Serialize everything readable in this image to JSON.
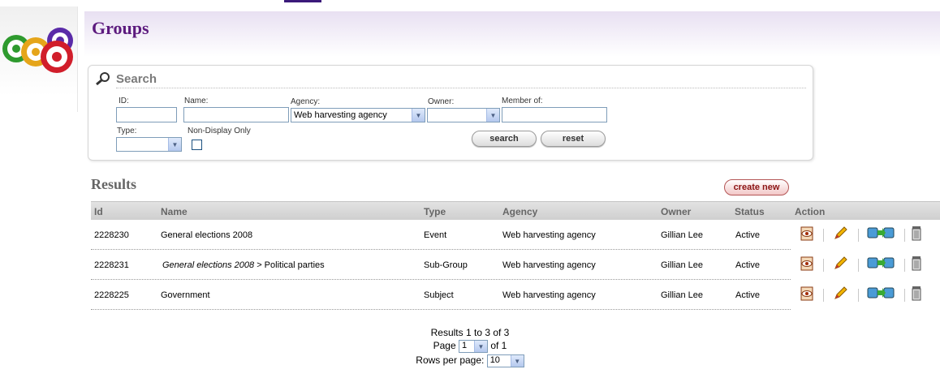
{
  "page_title": "Groups",
  "search": {
    "title": "Search",
    "id_label": "ID:",
    "id_value": "",
    "name_label": "Name:",
    "name_value": "",
    "agency_label": "Agency:",
    "agency_value": "Web harvesting agency",
    "owner_label": "Owner:",
    "owner_value": "",
    "member_label": "Member of:",
    "member_value": "",
    "type_label": "Type:",
    "type_value": "",
    "nondisplay_label": "Non-Display Only",
    "search_button": "search",
    "reset_button": "reset"
  },
  "results": {
    "title": "Results",
    "create_button": "create new",
    "columns": [
      "Id",
      "Name",
      "Type",
      "Agency",
      "Owner",
      "Status",
      "Action"
    ],
    "rows": [
      {
        "id": "2228230",
        "parent": "",
        "name": "General elections 2008",
        "type": "Event",
        "agency": "Web harvesting agency",
        "owner": "Gillian Lee",
        "status": "Active"
      },
      {
        "id": "2228231",
        "parent": "General elections 2008",
        "name": " > Political parties",
        "type": "Sub-Group",
        "agency": "Web harvesting agency",
        "owner": "Gillian Lee",
        "status": "Active"
      },
      {
        "id": "2228225",
        "parent": "",
        "name": "Government",
        "type": "Subject",
        "agency": "Web harvesting agency",
        "owner": "Gillian Lee",
        "status": "Active"
      }
    ],
    "action_icons": [
      "view-icon",
      "edit-pencil-icon",
      "transfer-icon",
      "trash-icon"
    ]
  },
  "pagination": {
    "summary": "Results 1 to 3 of 3",
    "page_label": "Page",
    "page_value": "1",
    "of_label": "of 1",
    "rows_label": "Rows per page:",
    "rows_value": "10"
  },
  "colors": {
    "title": "#5c1a7e",
    "header_gradient": "#e8e0f2",
    "create_button": "#8b1414"
  }
}
